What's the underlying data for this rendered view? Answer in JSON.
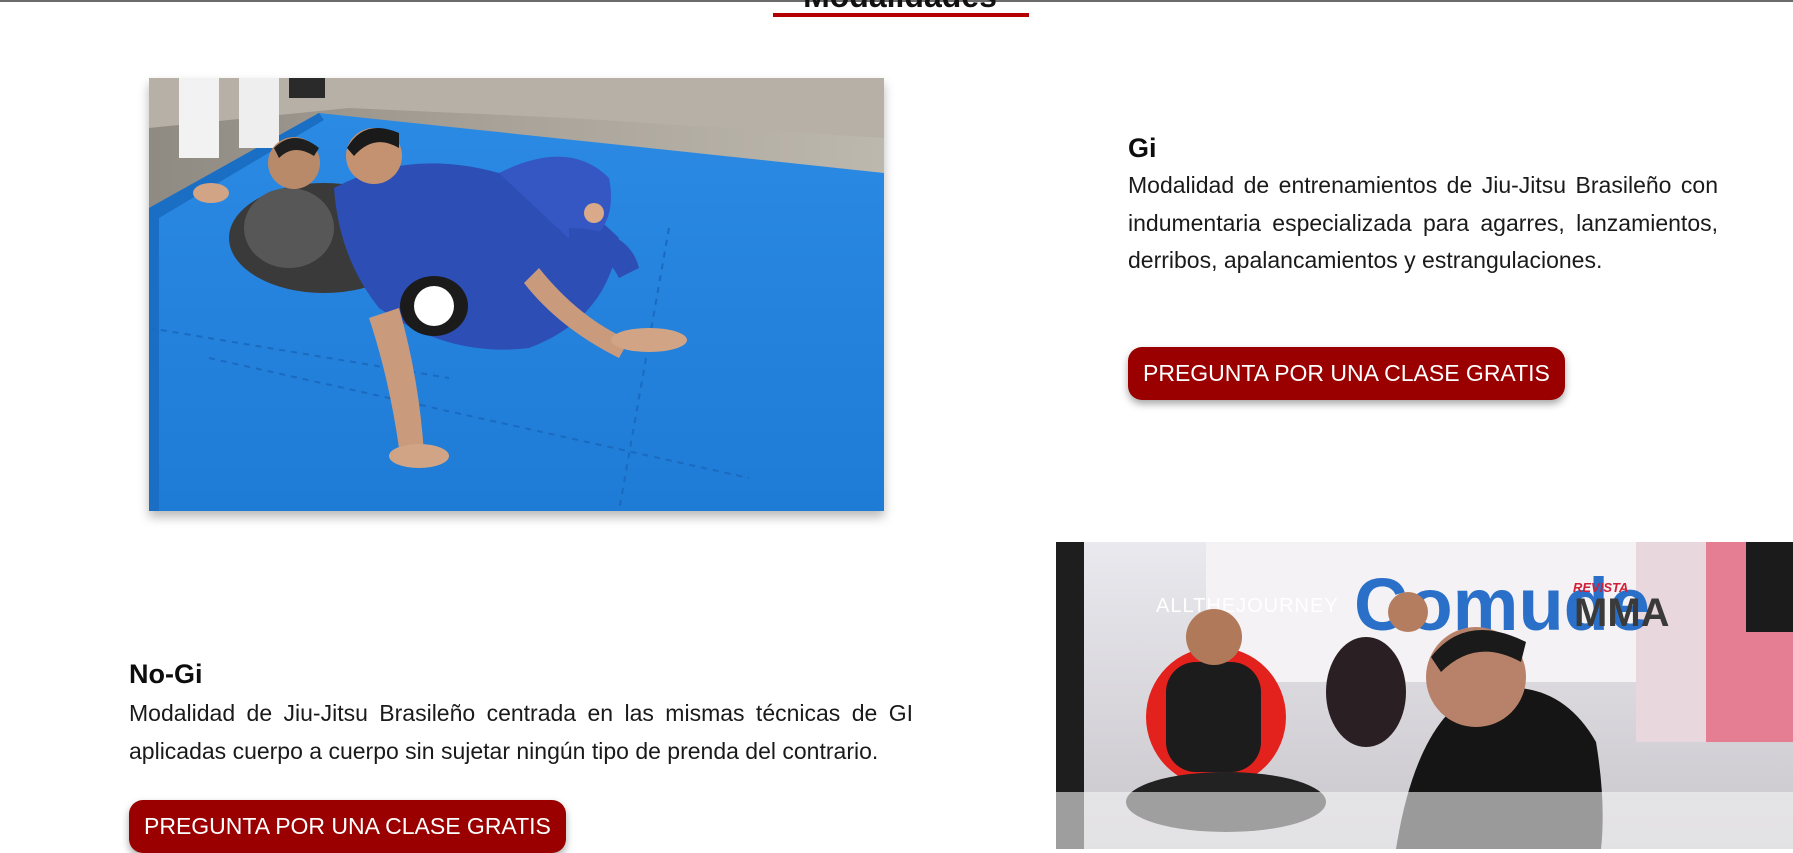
{
  "section": {
    "heading": "Modalidades"
  },
  "gi": {
    "title": "Gi",
    "description": "Modalidad de entrenamientos de Jiu-Jitsu Brasileño con indumentaria especializada para agarres, lanzamientos, derribos, apalancamientos y estrangulaciones.",
    "button_label": "PREGUNTA POR UNA CLASE GRATIS"
  },
  "nogi": {
    "title": "No-Gi",
    "description": "Modalidad de Jiu-Jitsu Brasileño centrada en las mismas técnicas de GI aplicadas cuerpo a cuerpo sin sujetar ningún tipo de prenda del contrario.",
    "button_label": "PREGUNTA POR UNA CLASE GRATIS",
    "photo_watermarks": {
      "brand": "ALLTHEJOURNEY",
      "banner": "Comude",
      "magazine_small": "REVISTA",
      "magazine": "MMA"
    }
  },
  "colors": {
    "accent_red": "#9a0000",
    "underline_red": "#b30000",
    "mat_blue": "#1f7fd9"
  }
}
